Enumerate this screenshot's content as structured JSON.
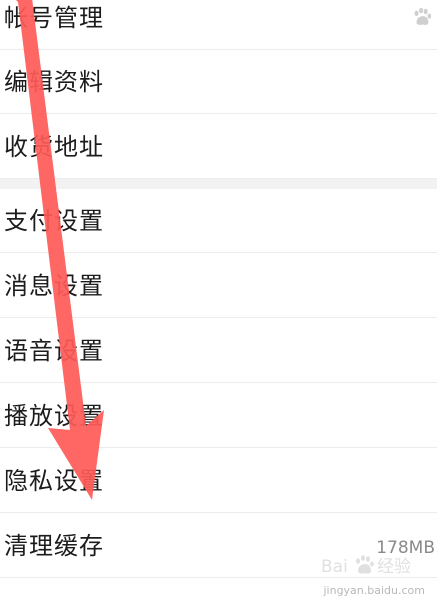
{
  "settings": {
    "items": [
      {
        "label": "帐号管理"
      },
      {
        "label": "编辑资料"
      },
      {
        "label": "收货地址"
      },
      {
        "label": "支付设置"
      },
      {
        "label": "消息设置"
      },
      {
        "label": "语音设置"
      },
      {
        "label": "播放设置"
      },
      {
        "label": "隐私设置"
      },
      {
        "label": "清理缓存",
        "value": "178MB"
      }
    ]
  },
  "watermark": {
    "text": "jingyan.baidu.com"
  },
  "colors": {
    "arrow": "#ff5a57",
    "separator": "#f2f2f2",
    "divider": "#ececec",
    "text": "#1c1c1c",
    "secondary_text": "#8a8a8a"
  }
}
